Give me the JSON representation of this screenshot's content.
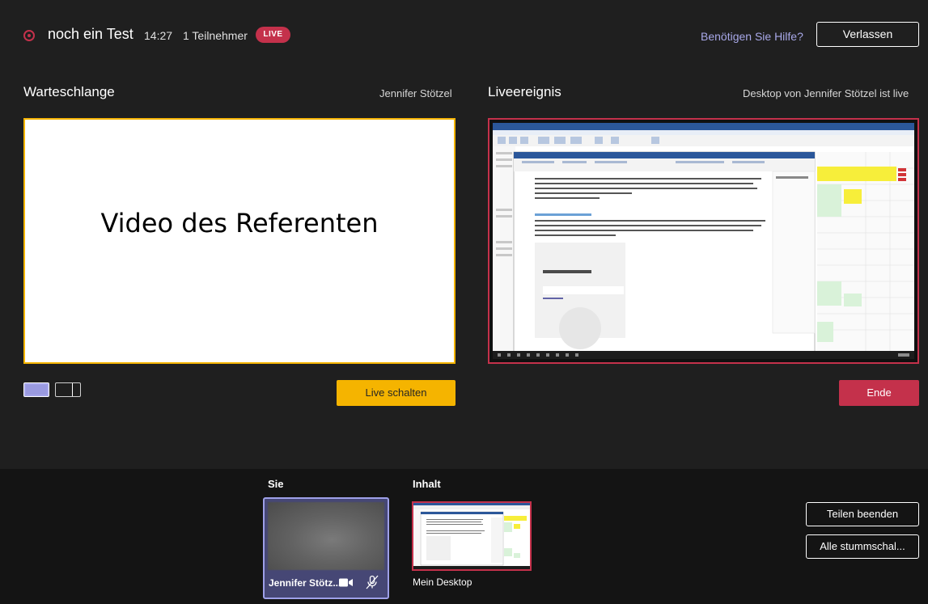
{
  "header": {
    "title": "noch ein Test",
    "timer": "14:27",
    "participants": "1 Teilnehmer",
    "live_badge": "LIVE",
    "help_link": "Benötigen Sie Hilfe?",
    "leave_label": "Verlassen"
  },
  "queue": {
    "title": "Warteschlange",
    "presenter": "Jennifer Stötzel",
    "preview_text": "Video des Referenten",
    "go_live_label": "Live schalten"
  },
  "live_event": {
    "title": "Liveereignis",
    "status": "Desktop von Jennifer Stötzel ist live",
    "end_label": "Ende"
  },
  "bottom": {
    "you_label": "Sie",
    "content_label": "Inhalt",
    "user_name": "Jennifer Stötz...",
    "content_name": "Mein Desktop",
    "stop_sharing_label": "Teilen beenden",
    "mute_all_label": "Alle stummschal..."
  },
  "colors": {
    "background": "#1f1f1f",
    "live_red": "#c4314b",
    "accent_yellow": "#f5b400",
    "accent_purple": "#9ea0e8"
  }
}
